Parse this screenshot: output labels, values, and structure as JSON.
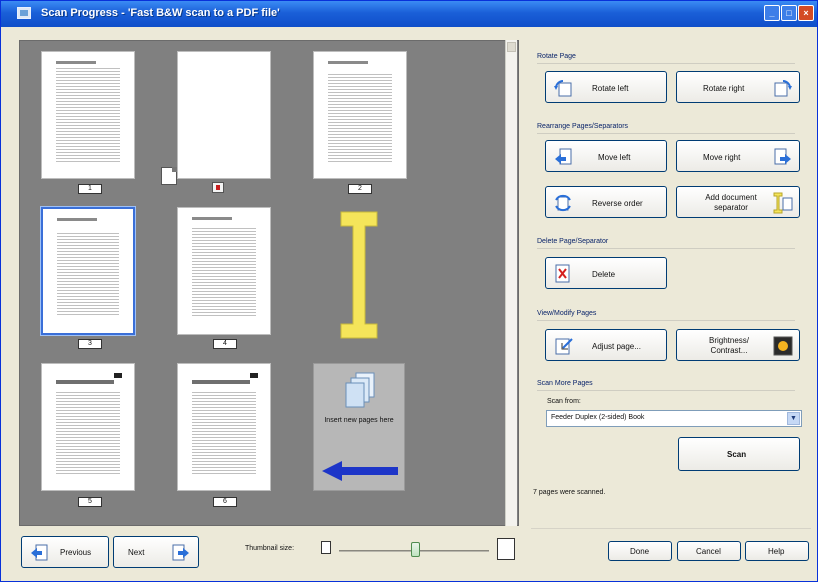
{
  "window": {
    "title": "Scan Progress - 'Fast B&W scan to a PDF file'",
    "buttons": {
      "minimize": "_",
      "maximize": "□",
      "close": "×"
    }
  },
  "thumbnails": {
    "pages": [
      {
        "number": "1"
      },
      {
        "number": "2"
      },
      {
        "number": "3"
      },
      {
        "number": "4"
      },
      {
        "number": "5"
      },
      {
        "number": "6"
      }
    ],
    "insert_tile_label": "Insert new pages here"
  },
  "bottom_bar": {
    "previous_label": "Previous",
    "next_label": "Next",
    "thumbnail_size_label": "Thumbnail size:"
  },
  "rotate": {
    "title": "Rotate Page",
    "left_label": "Rotate left",
    "right_label": "Rotate right"
  },
  "rearrange": {
    "title": "Rearrange Pages/Separators",
    "move_left_label": "Move left",
    "move_right_label": "Move right",
    "reverse_label": "Reverse order",
    "add_separator_label": "Add document separator"
  },
  "delete": {
    "title": "Delete Page/Separator",
    "delete_label": "Delete"
  },
  "view": {
    "title": "View/Modify Pages",
    "adjust_label": "Adjust page...",
    "brightness_label": "Brightness/ Contrast..."
  },
  "scan_more": {
    "title": "Scan More Pages",
    "scan_from_label": "Scan from:",
    "scan_from_value": "Feeder Duplex (2-sided) Book",
    "scan_label": "Scan"
  },
  "status_text": "7 pages were scanned.",
  "footer": {
    "done_label": "Done",
    "cancel_label": "Cancel",
    "help_label": "Help"
  },
  "colors": {
    "titlebar": "#1a5fd8",
    "pane_background": "#808080",
    "separator_yellow": "#f5e55a",
    "arrow_blue": "#1d35c8",
    "selected_border": "#3a6fd8"
  }
}
